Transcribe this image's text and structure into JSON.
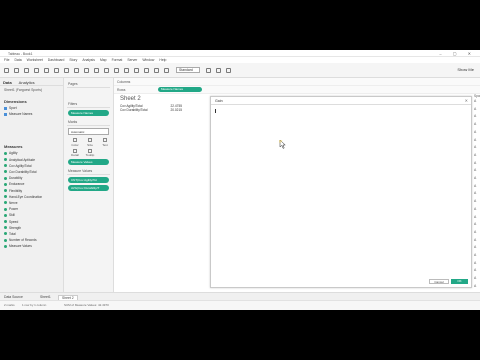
{
  "window": {
    "title": "Tableau - Book1",
    "controls": "– ▢ ✕"
  },
  "menu": [
    "File",
    "Data",
    "Worksheet",
    "Dashboard",
    "Story",
    "Analysis",
    "Map",
    "Format",
    "Server",
    "Window",
    "Help"
  ],
  "toolbar": {
    "fit": "Standard",
    "show_me": "Show Me"
  },
  "left_pane": {
    "tabs": [
      "Data",
      "Analytics"
    ],
    "datasource": "Sheet1 (Fargoest Sports)",
    "dimensions_header": "Dimensions",
    "dimensions": [
      "Sport",
      "Measure Names"
    ],
    "measures_header": "Measures",
    "measures": [
      "Agility",
      "Analytical Aptitude",
      "Cov Agility/Total",
      "Cov Durability/Total",
      "Durability",
      "Endurance",
      "Flexibility",
      "Hand-Eye Coordination",
      "Nerve",
      "Power",
      "Skill",
      "Speed",
      "Strength",
      "Total",
      "Number of Records",
      "Measure Values"
    ]
  },
  "pages_card": {
    "title": "Pages"
  },
  "filters_card": {
    "title": "Filters",
    "pill": "Measure Names"
  },
  "marks_card": {
    "title": "Marks",
    "type": "Automatic",
    "buttons": [
      "Color",
      "Size",
      "Text",
      "Detail",
      "Tooltip"
    ],
    "pill": "Measure Values"
  },
  "measure_values_card": {
    "title": "Measure Values",
    "pills": [
      "CNT(Cov Agility/Tot",
      "AVG(Cov Durability/T"
    ]
  },
  "shelves": {
    "columns_label": "Columns",
    "rows_label": "Rows",
    "rows_pill": "Measure Names"
  },
  "view": {
    "sheet_title": "Sheet 2",
    "rows": [
      {
        "label": "Cov Agility/Total",
        "value": "22.4755"
      },
      {
        "label": "Cov Durability/Total",
        "value": "20.0215"
      }
    ]
  },
  "dialog": {
    "title": "Gain",
    "close": "✕",
    "cancel": "Cancel",
    "ok": "OK"
  },
  "right_strip": {
    "header": "Sport",
    "glyphs": [
      "A",
      "A",
      "A",
      "A",
      "A",
      "A",
      "A",
      "A",
      "A",
      "A",
      "A",
      "A",
      "A",
      "A",
      "A",
      "A",
      "A",
      "A",
      "A",
      "A",
      "A",
      "A",
      "A",
      "A",
      "A"
    ]
  },
  "sheet_tabs": {
    "datasource": "Data Source",
    "sheets": [
      "Sheet1",
      "Sheet 2"
    ]
  },
  "status": {
    "marks": "2 marks",
    "rows_cols": "1 row by 1 column",
    "sum": "SUM of Measure Values: 42.4970"
  },
  "colors": {
    "accent": "#22a887",
    "dimension": "#4a90d9"
  }
}
